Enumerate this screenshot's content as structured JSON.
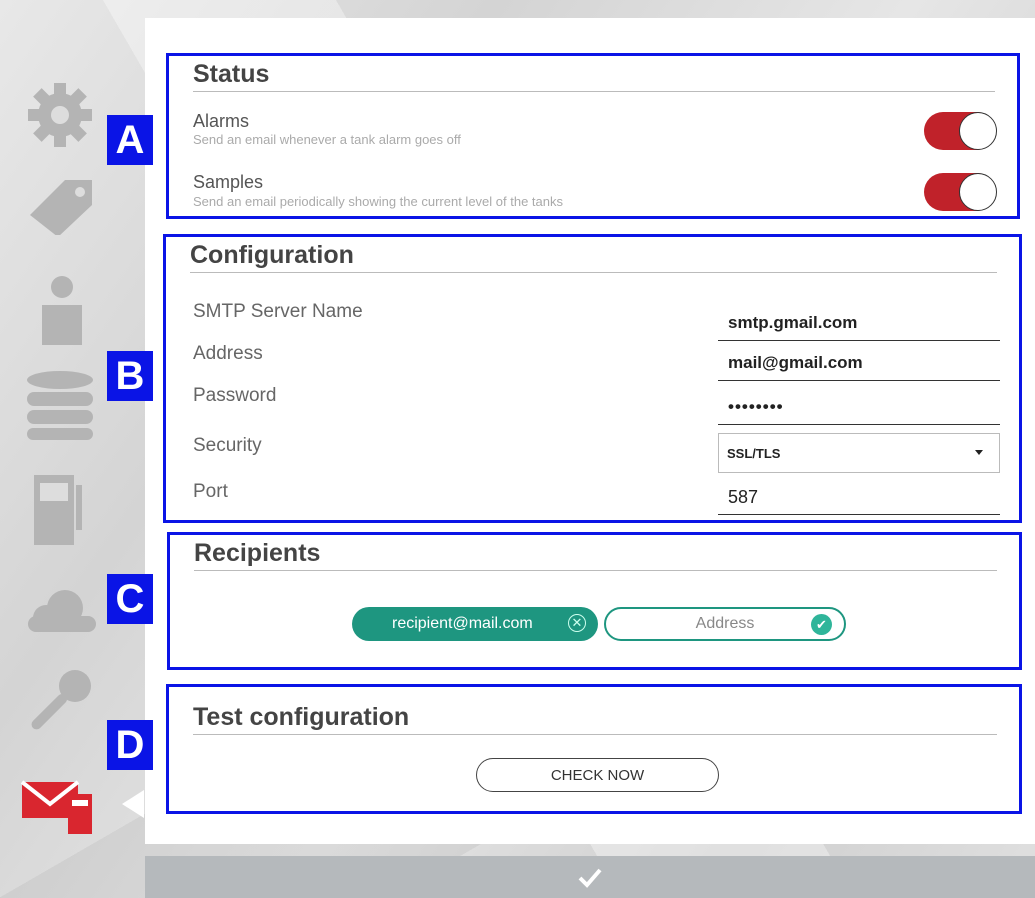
{
  "status": {
    "heading": "Status",
    "marker": "A",
    "alarms": {
      "title": "Alarms",
      "description": "Send an email whenever a tank alarm goes off",
      "enabled": true
    },
    "samples": {
      "title": "Samples",
      "description": "Send an email periodically showing the current level of the tanks",
      "enabled": true
    }
  },
  "configuration": {
    "heading": "Configuration",
    "marker": "B",
    "smtp_label": "SMTP Server Name",
    "smtp_value": "smtp.gmail.com",
    "address_label": "Address",
    "address_value": "mail@gmail.com",
    "password_label": "Password",
    "password_value": "••••••••",
    "security_label": "Security",
    "security_value": "SSL/TLS",
    "port_label": "Port",
    "port_value": "587"
  },
  "recipients": {
    "heading": "Recipients",
    "marker": "C",
    "chip": "recipient@mail.com",
    "input_placeholder": "Address"
  },
  "test": {
    "heading": "Test configuration",
    "marker": "D",
    "button": "CHECK NOW"
  },
  "colors": {
    "accent_blue": "#0a14e6",
    "toggle_red": "#c0222a",
    "teal": "#1e9680",
    "active_icon": "#d9262f",
    "sidebar_icon": "#b4b4b4"
  },
  "sidebar": {
    "items": [
      {
        "icon": "gear-icon"
      },
      {
        "icon": "tag-icon"
      },
      {
        "icon": "user-icon"
      },
      {
        "icon": "database-icon"
      },
      {
        "icon": "fuel-pump-icon"
      },
      {
        "icon": "cloud-icon"
      },
      {
        "icon": "key-icon"
      },
      {
        "icon": "email-icon",
        "active": true
      }
    ]
  },
  "footer": {
    "icon": "checkmark-icon"
  }
}
